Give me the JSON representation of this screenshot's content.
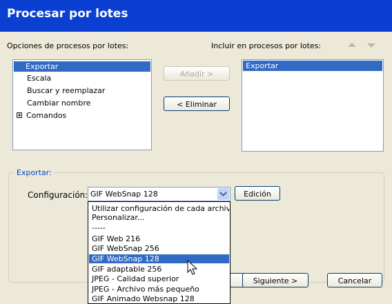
{
  "window": {
    "title": "Procesar por lotes"
  },
  "options": {
    "label": "Opciones de procesos por lotes:",
    "items": [
      "Exportar",
      "Escala",
      "Buscar y reemplazar",
      "Cambiar nombre",
      "Comandos"
    ],
    "selected": "Exportar",
    "comandos_expander": "⊞"
  },
  "include": {
    "label": "Incluir en procesos por lotes:",
    "items": [
      "Exportar"
    ]
  },
  "buttons": {
    "add": "Añadir >",
    "remove": "< Eliminar",
    "edit": "Edición",
    "next": "Siguiente >",
    "cancel": "Cancelar"
  },
  "export_group": {
    "title": "Exportar:",
    "config_label": "Configuración:",
    "config_value": "GIF WebSnap 128"
  },
  "dropdown": {
    "items": [
      "Utilizar configuración de cada archivo",
      "Personalizar...",
      "-----",
      "GIF Web 216",
      "GIF WebSnap 256",
      "GIF WebSnap 128",
      "GIF adaptable 256",
      "JPEG - Calidad superior",
      "JPEG - Archivo más pequeño",
      "GIF Animado Websnap 128"
    ],
    "selected": "GIF WebSnap 128"
  },
  "colors": {
    "titlebar": "#0a3fd1",
    "selection": "#316ac5",
    "group_title": "#0046d5",
    "dialog_bg": "#ece9d8"
  }
}
